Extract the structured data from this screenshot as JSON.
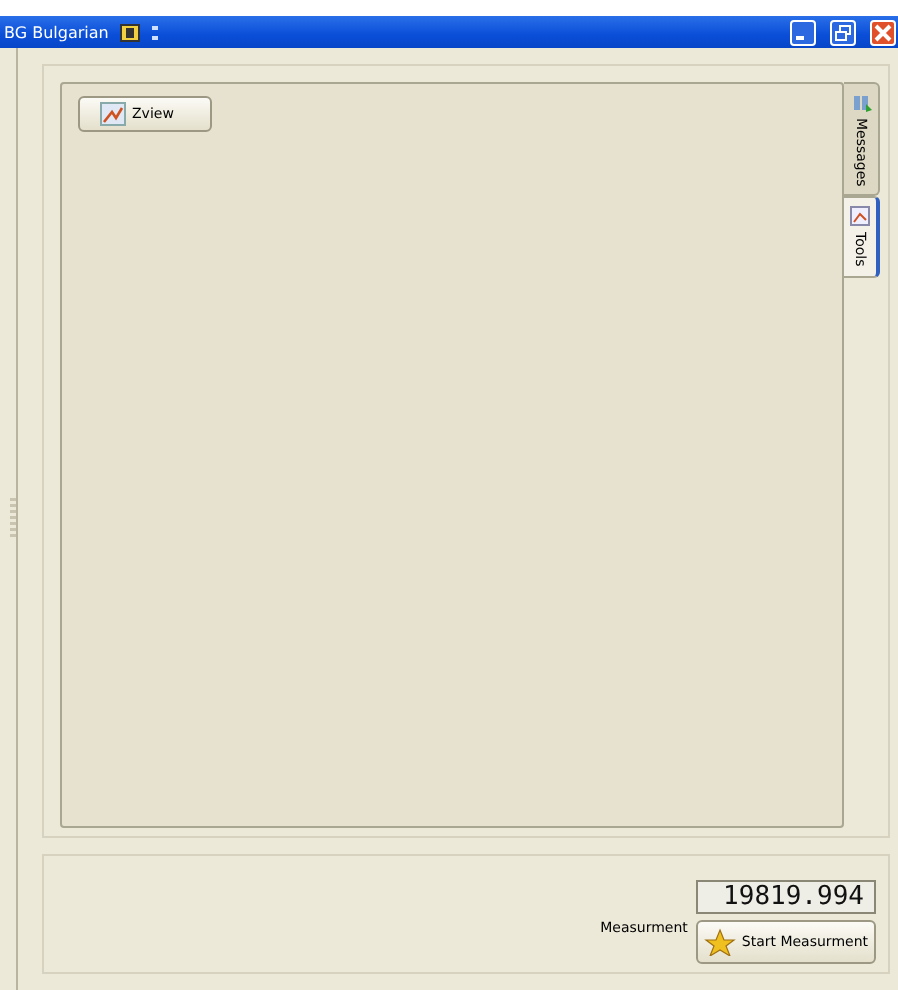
{
  "language_bar": {
    "label": "BG Bulgarian"
  },
  "toolbar": {
    "buttons": [
      "Zview"
    ]
  },
  "side_tabs": [
    {
      "label": "Messages",
      "selected": false
    },
    {
      "label": "Tools",
      "selected": true
    }
  ],
  "measurement": {
    "label": "Measurment",
    "reading": "19819.994",
    "button": "Start Measurment"
  }
}
